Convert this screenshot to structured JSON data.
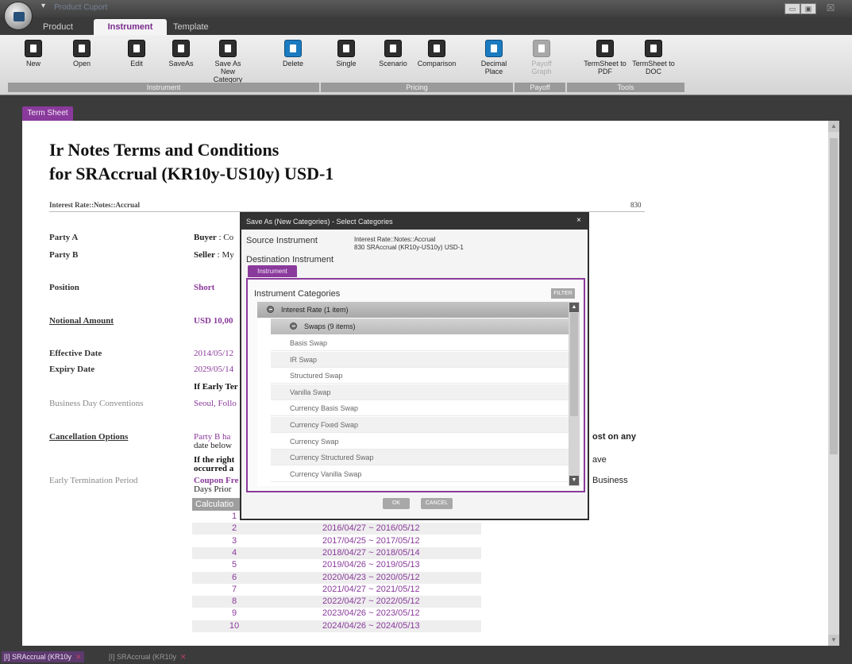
{
  "app": {
    "doc_indicator": "Product Cuport"
  },
  "window": {
    "minimize": "▭",
    "maximize": "▣",
    "close": "☒"
  },
  "ribbon": {
    "tabs": [
      "Product",
      "Instrument",
      "Template"
    ],
    "buttons": {
      "new": "New",
      "open": "Open",
      "edit": "Edit",
      "saveas": "SaveAs",
      "saveas_cat_1": "Save As",
      "saveas_cat_2": "New Category",
      "delete": "Delete",
      "single": "Single",
      "scenario": "Scenario",
      "comparison": "Comparison",
      "decimal_1": "Decimal",
      "decimal_2": "Place",
      "payoff_1": "Payoff",
      "payoff_2": "Graph",
      "ts_pdf_1": "TermSheet to",
      "ts_pdf_2": "PDF",
      "ts_doc_1": "TermSheet to",
      "ts_doc_2": "DOC"
    },
    "groups": {
      "instrument": "Instrument",
      "pricing": "Pricing",
      "payoff": "Payoff",
      "tools": "Tools"
    }
  },
  "doc_tab": "Term Sheet",
  "termsheet": {
    "title_line1": "Ir Notes Terms and Conditions",
    "title_line2": "for SRAccrual (KR10y-US10y) USD-1",
    "category": "Interest Rate::Notes::Accrual",
    "id": "830",
    "labels": {
      "party_a": "Party A",
      "party_b": "Party B",
      "position": "Position",
      "notional": "Notional Amount",
      "effective": "Effective Date",
      "expiry": "Expiry Date",
      "bdc": "Business Day Conventions",
      "cancellation": "Cancellation Options",
      "early_term": "Early Termination Period"
    },
    "values": {
      "buyer_label": "Buyer",
      "buyer_val": ": Co",
      "seller_label": "Seller",
      "seller_val": ": My",
      "position": "Short",
      "notional": "USD 10,00",
      "effective": "2014/05/12",
      "expiry": "2029/05/14",
      "if_early": "If Early Ter",
      "bdc": "Seoul, Follo",
      "canc_1": "Party B ha",
      "canc_1_tail": "ost on any",
      "canc_2": "date below",
      "canc_3": "If the right",
      "canc_3_tail": "ave",
      "canc_4": "occurred a",
      "coupon": "Coupon Fre",
      "coupon_tail": "Business",
      "days_prior": "Days Prior"
    },
    "calc_header": "Calculatio",
    "calc_rows": [
      {
        "n": "1",
        "period": "2015/04/27 ~ 2015/05/12"
      },
      {
        "n": "2",
        "period": "2016/04/27 ~ 2016/05/12"
      },
      {
        "n": "3",
        "period": "2017/04/25 ~ 2017/05/12"
      },
      {
        "n": "4",
        "period": "2018/04/27 ~ 2018/05/14"
      },
      {
        "n": "5",
        "period": "2019/04/26 ~ 2019/05/13"
      },
      {
        "n": "6",
        "period": "2020/04/23 ~ 2020/05/12"
      },
      {
        "n": "7",
        "period": "2021/04/27 ~ 2021/05/12"
      },
      {
        "n": "8",
        "period": "2022/04/27 ~ 2022/05/12"
      },
      {
        "n": "9",
        "period": "2023/04/26 ~ 2023/05/12"
      },
      {
        "n": "10",
        "period": "2024/04/26 ~ 2024/05/13"
      }
    ]
  },
  "bottom_tabs": [
    "[I] SRAccrual (KR10y",
    "[I] SRAccrual (KR10y"
  ],
  "dialog": {
    "title": "Save As (New Categories) - Select Categories",
    "close": "×",
    "source_label": "Source Instrument",
    "source_val_1": "Interest Rate::Notes::Accrual",
    "source_val_2": "830  SRAccrual (KR10y-US10y) USD-1",
    "dest_label": "Destination Instrument",
    "tab": "Instrument",
    "categories_title": "Instrument Categories",
    "filter": "FILTER",
    "tree": {
      "root": "Interest Rate (1 item)",
      "child": "Swaps (9 items)",
      "leaves": [
        "Basis Swap",
        "IR Swap",
        "Structured Swap",
        "Vanilla Swap",
        "Currency Basis Swap",
        "Currency Fixed Swap",
        "Currency Swap",
        "Currency Structured Swap",
        "Currency Vanilla Swap"
      ]
    },
    "ok": "OK",
    "cancel": "CANCEL"
  },
  "colors": {
    "accent": "#8a3a9c",
    "ribbon": "#e4e4e4",
    "chrome": "#3b3b3b"
  }
}
